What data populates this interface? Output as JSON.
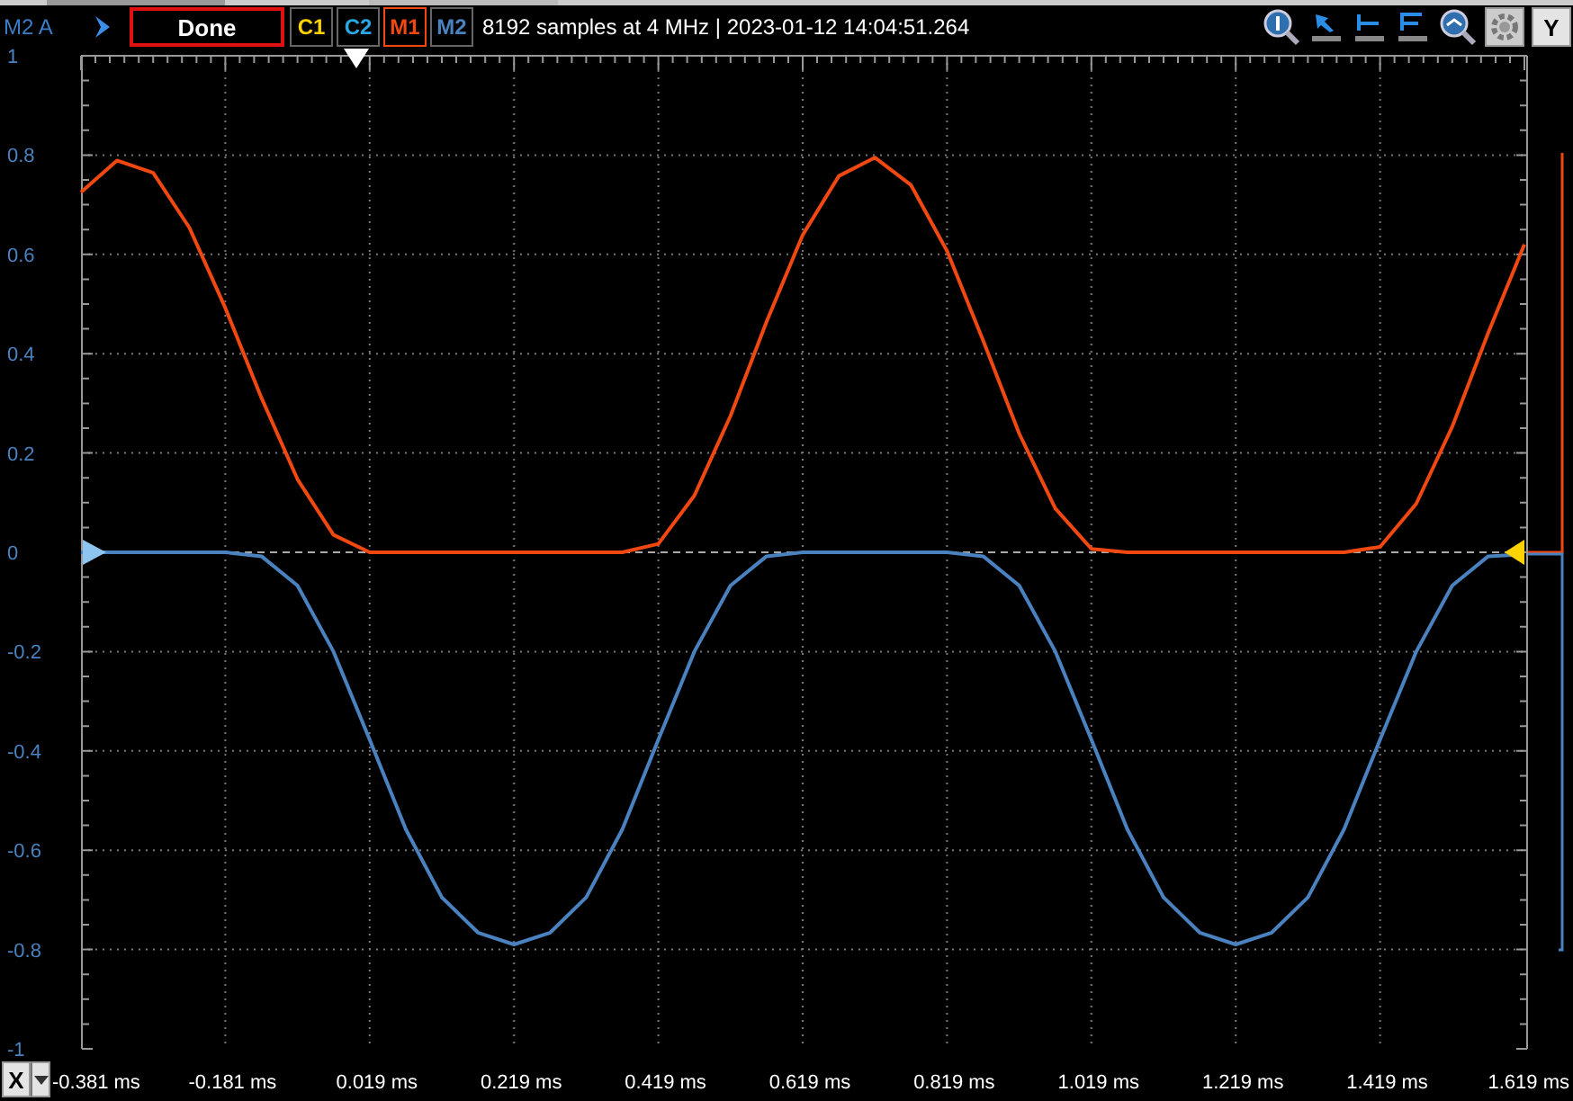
{
  "header": {
    "channel_label": "M2 A",
    "status": "Done",
    "channels": [
      {
        "label": "C1",
        "color": "#ffd200",
        "selected": false
      },
      {
        "label": "C2",
        "color": "#2aa8e6",
        "selected": false
      },
      {
        "label": "M1",
        "color": "#f04810",
        "selected": true
      },
      {
        "label": "M2",
        "color": "#4a82c0",
        "selected": false
      }
    ],
    "info": "8192 samples at 4 MHz | 2023-01-12 14:04:51.264",
    "y_button": "Y"
  },
  "plot": {
    "x_button": "X",
    "chart_data": {
      "type": "line",
      "x": [
        -0.381,
        -0.331,
        -0.281,
        -0.231,
        -0.181,
        -0.131,
        -0.081,
        -0.031,
        0.019,
        0.069,
        0.119,
        0.169,
        0.219,
        0.269,
        0.319,
        0.369,
        0.419,
        0.469,
        0.519,
        0.569,
        0.619,
        0.669,
        0.719,
        0.769,
        0.819,
        0.869,
        0.919,
        0.969,
        1.019,
        1.069,
        1.119,
        1.169,
        1.219,
        1.269,
        1.319,
        1.369,
        1.419,
        1.469,
        1.519,
        1.569,
        1.619
      ],
      "series": [
        {
          "color": "#f04810",
          "values": [
            0.725,
            0.789,
            0.764,
            0.654,
            0.492,
            0.311,
            0.147,
            0.035,
            0,
            0,
            0,
            0,
            0,
            0,
            0,
            0,
            0.017,
            0.114,
            0.275,
            0.464,
            0.639,
            0.758,
            0.795,
            0.74,
            0.607,
            0.426,
            0.239,
            0.088,
            0.007,
            0,
            0,
            0,
            0,
            0,
            0,
            0,
            0.011,
            0.098,
            0.253,
            0.442,
            0.62
          ]
        },
        {
          "color": "#4a82c0",
          "values": [
            0,
            0,
            0,
            0,
            0,
            -0.008,
            -0.067,
            -0.2,
            -0.377,
            -0.558,
            -0.695,
            -0.766,
            -0.79,
            -0.766,
            -0.695,
            -0.558,
            -0.377,
            -0.2,
            -0.067,
            -0.008,
            0,
            0,
            0,
            0,
            0,
            -0.008,
            -0.067,
            -0.2,
            -0.377,
            -0.558,
            -0.695,
            -0.766,
            -0.79,
            -0.766,
            -0.695,
            -0.558,
            -0.377,
            -0.2,
            -0.067,
            -0.008,
            -0.004
          ]
        }
      ],
      "grid": true,
      "ref_lines": [
        {
          "axis": "y",
          "value": 0
        }
      ],
      "xlim": [
        -0.381,
        1.619
      ],
      "ylim": [
        -1,
        1
      ],
      "xticks": [
        {
          "value": -0.381,
          "label": "-0.381 ms"
        },
        {
          "value": -0.181,
          "label": "-0.181 ms"
        },
        {
          "value": 0.019,
          "label": "0.019 ms"
        },
        {
          "value": 0.219,
          "label": "0.219 ms"
        },
        {
          "value": 0.419,
          "label": "0.419 ms"
        },
        {
          "value": 0.619,
          "label": "0.619 ms"
        },
        {
          "value": 0.819,
          "label": "0.819 ms"
        },
        {
          "value": 1.019,
          "label": "1.019 ms"
        },
        {
          "value": 1.219,
          "label": "1.219 ms"
        },
        {
          "value": 1.419,
          "label": "1.419 ms"
        },
        {
          "value": 1.619,
          "label": "1.619 ms"
        }
      ],
      "yticks": [
        {
          "value": 1,
          "label": "1"
        },
        {
          "value": 0.8,
          "label": "0.8"
        },
        {
          "value": 0.6,
          "label": "0.6"
        },
        {
          "value": 0.4,
          "label": "0.4"
        },
        {
          "value": 0.2,
          "label": "0.2"
        },
        {
          "value": 0,
          "label": "0"
        },
        {
          "value": -0.2,
          "label": "-0.2"
        },
        {
          "value": -0.4,
          "label": "-0.4"
        },
        {
          "value": -0.6,
          "label": "-0.6"
        },
        {
          "value": -0.8,
          "label": "-0.8"
        },
        {
          "value": -1,
          "label": "-1"
        }
      ]
    }
  }
}
